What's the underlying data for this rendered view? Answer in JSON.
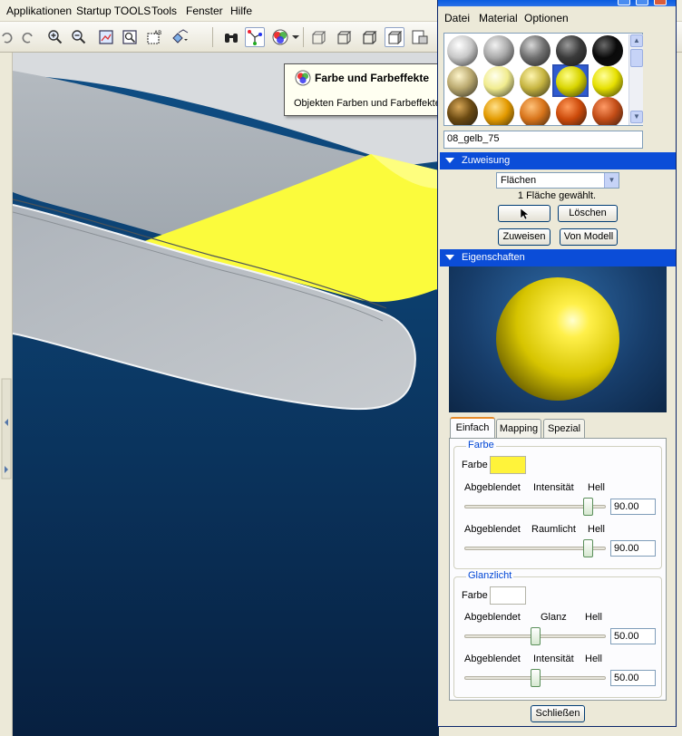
{
  "app": {
    "menu": [
      "Applikationen",
      "Startup TOOLS",
      "Tools",
      "Fenster",
      "Hilfe"
    ]
  },
  "tooltip": {
    "title": "Farbe und Farbeffekte",
    "description": "Objekten Farben und Farbeffekte zuweisen"
  },
  "side_buttons": {
    "plus": "+",
    "minus": "−"
  },
  "editor": {
    "menu": [
      "Datei",
      "Material",
      "Optionen"
    ],
    "material_name": "08_gelb_75",
    "swatches": [
      {
        "color": "#c8c8c8",
        "hl": "#ffffff"
      },
      {
        "color": "#a9a9a9",
        "hl": "#f2f2f2"
      },
      {
        "color": "#707070",
        "hl": "#d8d8d8"
      },
      {
        "color": "#3a3a3a",
        "hl": "#9a9a9a"
      },
      {
        "color": "#0a0a0a",
        "hl": "#6a6a6a"
      },
      {
        "color": "#b9a86e",
        "hl": "#fff6cc"
      },
      {
        "color": "#f1ec8e",
        "hl": "#ffffee"
      },
      {
        "color": "#c6b440",
        "hl": "#fff6b0"
      },
      {
        "color": "#d8d400",
        "hl": "#ffff88"
      },
      {
        "color": "#e6e000",
        "hl": "#ffff9a"
      },
      {
        "color": "#6b4a12",
        "hl": "#d8a858"
      },
      {
        "color": "#e39a00",
        "hl": "#ffe08a"
      },
      {
        "color": "#d8741a",
        "hl": "#ffc27a"
      },
      {
        "color": "#cc4a0a",
        "hl": "#ff9a5a"
      },
      {
        "color": "#c24c16",
        "hl": "#ff9a66"
      }
    ],
    "selected_swatch": 8,
    "assignment": {
      "header": "Zuweisung",
      "selection_type": "Flächen",
      "status": "1 Fläche gewählt.",
      "buttons": {
        "delete": "Löschen",
        "assign": "Zuweisen",
        "from_model": "Von Modell"
      }
    },
    "properties": {
      "header": "Eigenschaften",
      "tabs": [
        "Einfach",
        "Mapping",
        "Spezial"
      ],
      "active_tab": 0,
      "color_group": {
        "legend": "Farbe",
        "color_label": "Farbe",
        "color": "#fff33a",
        "rows": [
          {
            "low": "Abgeblendet",
            "name": "Intensität",
            "high": "Hell",
            "value": "90.00",
            "level": 90
          },
          {
            "low": "Abgeblendet",
            "name": "Raumlicht",
            "high": "Hell",
            "value": "90.00",
            "level": 90
          }
        ]
      },
      "highlight_group": {
        "legend": "Glanzlicht",
        "color_label": "Farbe",
        "color": "#ffffff",
        "rows": [
          {
            "low": "Abgeblendet",
            "name": "Glanz",
            "high": "Hell",
            "value": "50.00",
            "level": 50
          },
          {
            "low": "Abgeblendet",
            "name": "Intensität",
            "high": "Hell",
            "value": "50.00",
            "level": 50
          }
        ]
      }
    },
    "close_button": "Schließen"
  },
  "colors": {
    "viewport_top": "#0f4f86",
    "viewport_bottom": "#072040",
    "surface_grey": "#b8bdc2",
    "surface_yellow": "#fbfb3c",
    "selection_blue": "#0b4dd8"
  }
}
